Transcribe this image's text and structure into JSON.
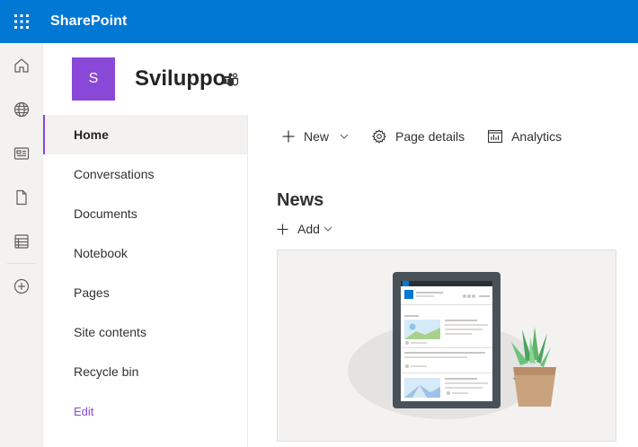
{
  "suite": {
    "app_name": "SharePoint",
    "waffle_icon": "waffle-icon"
  },
  "appbar": {
    "items": [
      {
        "name": "home",
        "icon": "home-icon"
      },
      {
        "name": "sites",
        "icon": "globe-icon"
      },
      {
        "name": "news",
        "icon": "news-icon"
      },
      {
        "name": "files",
        "icon": "file-icon"
      },
      {
        "name": "lists",
        "icon": "list-icon"
      },
      {
        "name": "create",
        "icon": "add-circle-icon"
      }
    ]
  },
  "site": {
    "logo_letter": "S",
    "title": "Sviluppo",
    "logo_color": "#8a48d9",
    "teams_icon": "teams-icon"
  },
  "nav": {
    "items": [
      {
        "label": "Home",
        "selected": true
      },
      {
        "label": "Conversations"
      },
      {
        "label": "Documents"
      },
      {
        "label": "Notebook"
      },
      {
        "label": "Pages"
      },
      {
        "label": "Site contents"
      },
      {
        "label": "Recycle bin"
      }
    ],
    "edit_label": "Edit"
  },
  "commands": {
    "new_label": "New",
    "page_details_label": "Page details",
    "analytics_label": "Analytics"
  },
  "news": {
    "title": "News",
    "add_label": "Add"
  },
  "colors": {
    "suite_bar": "#0078d4",
    "accent": "#8a48d9"
  }
}
